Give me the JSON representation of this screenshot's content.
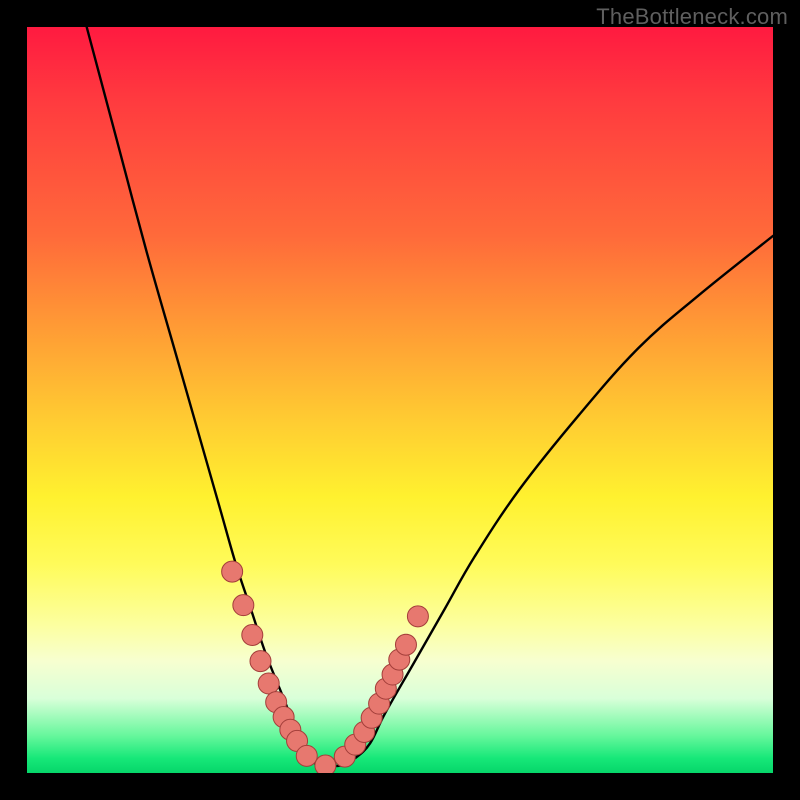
{
  "watermark": "TheBottleneck.com",
  "chart_data": {
    "type": "line",
    "title": "",
    "xlabel": "",
    "ylabel": "",
    "xlim": [
      0,
      100
    ],
    "ylim": [
      0,
      100
    ],
    "series": [
      {
        "name": "bottleneck-curve",
        "x": [
          8,
          12,
          16,
          20,
          24,
          26,
          28,
          30,
          32,
          34,
          36,
          37,
          38,
          39,
          40,
          42,
          44,
          46,
          48,
          52,
          56,
          60,
          66,
          74,
          82,
          90,
          100
        ],
        "values": [
          100,
          85,
          70,
          56,
          42,
          35,
          28,
          22,
          16,
          11,
          6,
          4,
          2,
          1,
          1,
          1,
          2,
          4,
          8,
          15,
          22,
          29,
          38,
          48,
          57,
          64,
          72
        ]
      }
    ],
    "markers": {
      "name": "highlight-dots",
      "x": [
        27.5,
        29,
        30.2,
        31.3,
        32.4,
        33.4,
        34.4,
        35.3,
        36.2,
        37.5,
        40,
        42.6,
        44,
        45.2,
        46.2,
        47.2,
        48.1,
        49,
        49.9,
        50.8,
        52.4
      ],
      "values": [
        27,
        22.5,
        18.5,
        15,
        12,
        9.5,
        7.5,
        5.8,
        4.3,
        2.3,
        1,
        2.2,
        3.8,
        5.5,
        7.4,
        9.3,
        11.3,
        13.2,
        15.2,
        17.2,
        21
      ]
    },
    "colors": {
      "curve": "#000000",
      "marker_fill": "#e7786f",
      "marker_stroke": "#a33e3a"
    }
  }
}
